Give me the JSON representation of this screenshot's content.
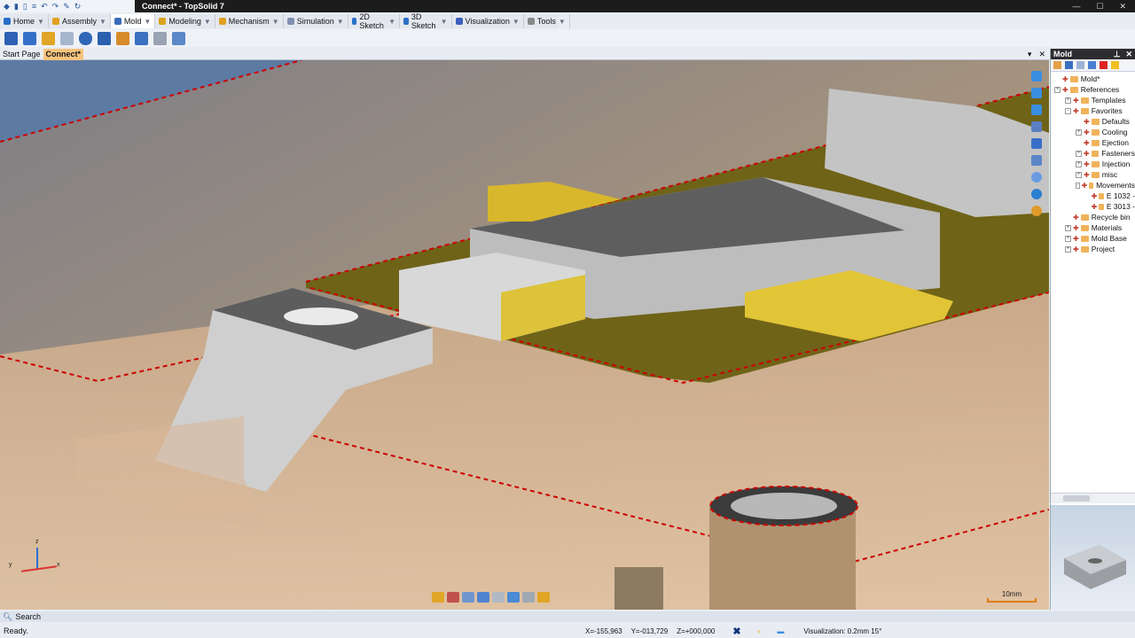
{
  "window": {
    "title": "Connect* - TopSolid 7",
    "minimize": "—",
    "maximize": "☐",
    "close": "✕"
  },
  "menu": [
    {
      "label": "Home",
      "color": "#2a6fc9"
    },
    {
      "label": "Assembly",
      "color": "#e0a020"
    },
    {
      "label": "Mold",
      "color": "#3a6bb8"
    },
    {
      "label": "Modeling",
      "color": "#d9a21c"
    },
    {
      "label": "Mechanism",
      "color": "#e0a020"
    },
    {
      "label": "Simulation",
      "color": "#7f8fb0"
    },
    {
      "label": "2D Sketch",
      "color": "#2a6fc9"
    },
    {
      "label": "3D Sketch",
      "color": "#2a6fc9"
    },
    {
      "label": "Visualization",
      "color": "#3a5fc0"
    },
    {
      "label": "Tools",
      "color": "#888"
    }
  ],
  "doc_tabs": {
    "start": "Start Page",
    "active": "Connect*"
  },
  "panel": {
    "title": "Mold",
    "tree": [
      {
        "label": "Mold*",
        "level": 0,
        "exp": ""
      },
      {
        "label": "References",
        "level": 0,
        "exp": "+"
      },
      {
        "label": "Templates",
        "level": 1,
        "exp": "+"
      },
      {
        "label": "Favorites",
        "level": 1,
        "exp": "-"
      },
      {
        "label": "Defaults",
        "level": 2,
        "exp": ""
      },
      {
        "label": "Cooling",
        "level": 2,
        "exp": "+"
      },
      {
        "label": "Ejection",
        "level": 2,
        "exp": ""
      },
      {
        "label": "Fasteners",
        "level": 2,
        "exp": "+"
      },
      {
        "label": "Injection",
        "level": 2,
        "exp": "+"
      },
      {
        "label": "misc",
        "level": 2,
        "exp": "+"
      },
      {
        "label": "Movements",
        "level": 2,
        "exp": "-"
      },
      {
        "label": "E 1032 -",
        "level": 3,
        "exp": ""
      },
      {
        "label": "E 3013 -",
        "level": 3,
        "exp": ""
      },
      {
        "label": "Recycle bin",
        "level": 1,
        "exp": ""
      },
      {
        "label": "Materials",
        "level": 1,
        "exp": "+"
      },
      {
        "label": "Mold Base",
        "level": 1,
        "exp": "+"
      },
      {
        "label": "Project",
        "level": 1,
        "exp": "+"
      }
    ]
  },
  "viewport": {
    "scale_label": "10mm",
    "axis_labels": {
      "x": "x",
      "y": "y",
      "z": "z"
    }
  },
  "search": {
    "label": "Search"
  },
  "status": {
    "text": "Ready.",
    "x": "X=-155,963",
    "y": "Y=-013,729",
    "z": "Z=+000,000",
    "visualization": "Visualization: 0.2mm 15°"
  }
}
